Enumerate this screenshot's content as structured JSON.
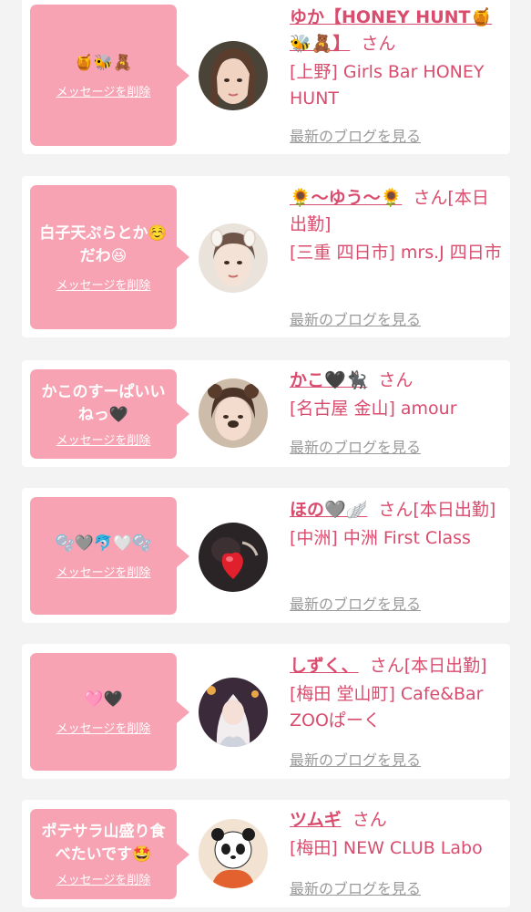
{
  "delete_label": "メッセージを削除",
  "blog_label": "最新のブログを見る",
  "cards": [
    {
      "message": "🍯🐝🧸",
      "name": "ゆか【HONEY HUNT🍯🐝🧸】",
      "suffix": "さん",
      "shop": "[上野] Girls Bar HONEY HUNT"
    },
    {
      "message": "白子天ぷらとか☺️だわ😆",
      "name": "🌻〜ゆう〜🌻",
      "suffix": "さん[本日出勤]",
      "shop": "[三重 四日市] mrs.J 四日市"
    },
    {
      "message": "かこのすーぱいいねっ🖤",
      "name": "かこ🖤🐈‍⬛",
      "suffix": "さん",
      "shop": "[名古屋 金山] amour"
    },
    {
      "message": "🫧🩶🐬🤍🫧",
      "name": "ほの🩶🪽",
      "suffix": "さん[本日出勤]",
      "shop": "[中洲] 中洲 First Class"
    },
    {
      "message": "🩷🖤",
      "name": "しずく、",
      "suffix": "さん[本日出勤]",
      "shop": "[梅田 堂山町] Cafe&Bar ZOOぱーく"
    },
    {
      "message": "ポテサラ山盛り食べたいです🤩",
      "name": "ツムギ",
      "suffix": "さん",
      "shop": "[梅田] NEW CLUB Labo"
    }
  ],
  "colors": {
    "accent": "#d94c6e",
    "bubble": "#f7a3b3",
    "muted": "#9a9a9a",
    "background": "#f3f3f3"
  }
}
